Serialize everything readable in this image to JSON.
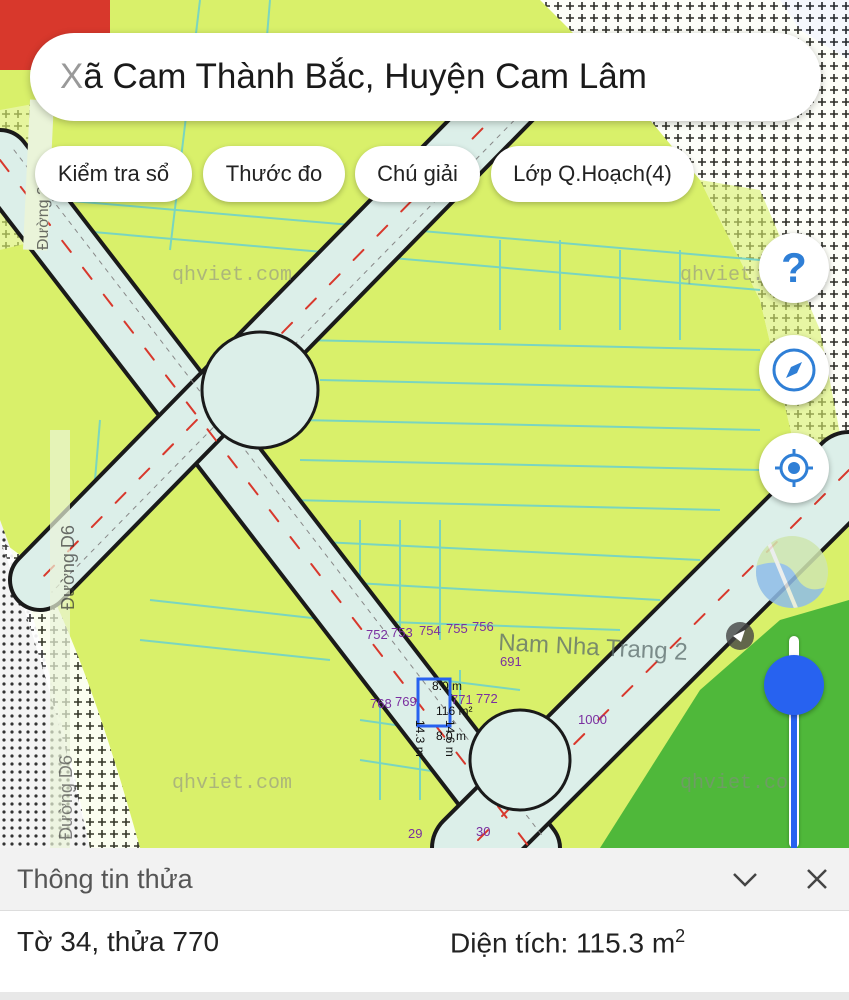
{
  "search": {
    "prefix": "X",
    "text": "ã Cam Thành Bắc, Huyện Cam Lâm"
  },
  "chips": [
    "Kiểm tra sổ",
    "Thước đo",
    "Chú giải",
    "Lớp Q.Hoạch(4)"
  ],
  "colors": {
    "accent": "#2762f0",
    "landuse": "#d9f06a",
    "road": "#dcefe9",
    "green": "#4fb83a",
    "parcel_label": "#7a2fa0"
  },
  "map": {
    "watermarks": [
      "qhviet.com",
      "qhviet.com",
      "qhviet.com",
      "qhviet.com"
    ],
    "road_labels": {
      "left_top": "Đường 204",
      "left_mid": "Đường D6",
      "left_bottom": "Đường D6",
      "right": "Nam Nha Trang 2"
    },
    "parcel_numbers": [
      "752",
      "753",
      "754",
      "755",
      "756",
      "691",
      "768",
      "769",
      "771",
      "772",
      "1000",
      "29",
      "30"
    ],
    "measurements": {
      "top": "8.0 m",
      "area": "116 m²",
      "left": "14.3 m",
      "right": "14.6 m",
      "bottom": "8.0 m"
    }
  },
  "fabs": [
    "help-icon",
    "compass-icon",
    "locate-icon"
  ],
  "panel": {
    "title": "Thông tin thửa",
    "sheet_parcel": "Tờ 34, thửa 770",
    "area_label": "Diện tích: 115.3 m",
    "area_sup": "2"
  }
}
